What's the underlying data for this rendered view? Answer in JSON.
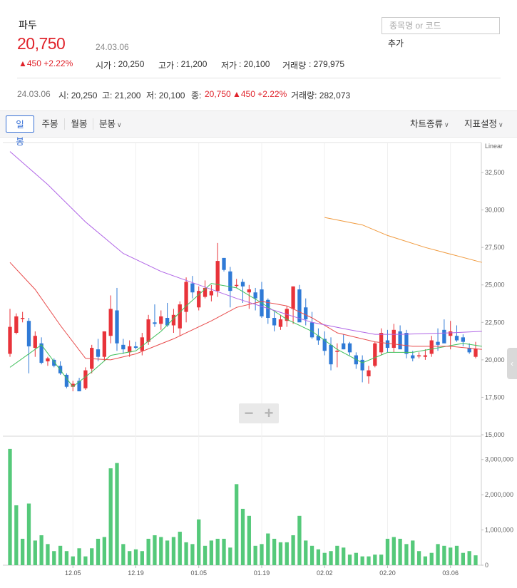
{
  "stock": {
    "name": "파두",
    "price": "20,750",
    "date": "24.03.06",
    "change": "▲450 +2.22%",
    "open_label": "시가",
    "open": ": 20,250",
    "high_label": "고가",
    "high": ": 21,200",
    "low_label": "저가",
    "low": ": 20,100",
    "volume_label": "거래량",
    "volume": ": 279,975"
  },
  "search": {
    "placeholder": "종목명 or 코드",
    "add_label": "추가"
  },
  "summary": {
    "date": "24.03.06",
    "open": "시: 20,250",
    "high": "고: 21,200",
    "low": "저: 20,100",
    "close_label": "종:",
    "close": "20,750",
    "change": "▲450 +2.22%",
    "volume": "거래량: 282,073"
  },
  "toolbar": {
    "tabs": [
      "일봉",
      "주봉",
      "월봉",
      "분봉"
    ],
    "active_tab": "일봉",
    "chart_type_label": "차트종류",
    "indicator_label": "지표설정"
  },
  "colors": {
    "up": "#e8333a",
    "down": "#2f7ad6",
    "ma5": "#3fbf5a",
    "ma20": "#e84b4b",
    "ma60": "#b065e6",
    "ma120": "#f09a3e",
    "volume": "#55c97a",
    "accent": "#3a72d6"
  },
  "icons": {
    "zoom_out": "−",
    "zoom_in": "+",
    "side_handle": "‹"
  },
  "chart_data": {
    "type": "candlestick",
    "scale_label": "Linear",
    "price_ticks": [
      32500,
      30000,
      27500,
      25000,
      22500,
      20000,
      17500,
      15000
    ],
    "price_tick_labels": [
      "32,500",
      "30,000",
      "27,500",
      "25,000",
      "22,500",
      "20,000",
      "17,500",
      "15,000"
    ],
    "ylim": [
      15000,
      34500
    ],
    "volume_ticks": [
      3000000,
      2000000,
      1000000,
      0
    ],
    "volume_tick_labels": [
      "3,000,000",
      "2,000,000",
      "1,000,000",
      "0"
    ],
    "volume_ylim": [
      0,
      3500000
    ],
    "x_tick_labels": [
      {
        "i": 10,
        "label": "12.05"
      },
      {
        "i": 20,
        "label": "12.19"
      },
      {
        "i": 30,
        "label": "01.05"
      },
      {
        "i": 40,
        "label": "01.19"
      },
      {
        "i": 50,
        "label": "02.02"
      },
      {
        "i": 60,
        "label": "02.20"
      },
      {
        "i": 70,
        "label": "03.06"
      }
    ],
    "candles": [
      {
        "o": 20400,
        "h": 23400,
        "l": 20200,
        "c": 22200,
        "v": 3300000
      },
      {
        "o": 21800,
        "h": 23100,
        "l": 21700,
        "c": 22900,
        "v": 1700000
      },
      {
        "o": 22800,
        "h": 23200,
        "l": 22500,
        "c": 22800,
        "v": 750000
      },
      {
        "o": 22600,
        "h": 22800,
        "l": 19100,
        "c": 20900,
        "v": 1750000
      },
      {
        "o": 20800,
        "h": 21900,
        "l": 20200,
        "c": 21600,
        "v": 700000
      },
      {
        "o": 21100,
        "h": 21500,
        "l": 19700,
        "c": 19800,
        "v": 850000
      },
      {
        "o": 19900,
        "h": 20200,
        "l": 19600,
        "c": 20100,
        "v": 600000
      },
      {
        "o": 20000,
        "h": 20100,
        "l": 19500,
        "c": 19600,
        "v": 400000
      },
      {
        "o": 19600,
        "h": 19900,
        "l": 19000,
        "c": 19100,
        "v": 550000
      },
      {
        "o": 19000,
        "h": 19100,
        "l": 18100,
        "c": 18200,
        "v": 400000
      },
      {
        "o": 18200,
        "h": 18600,
        "l": 17900,
        "c": 18400,
        "v": 250000
      },
      {
        "o": 18600,
        "h": 18800,
        "l": 17900,
        "c": 17900,
        "v": 480000
      },
      {
        "o": 18100,
        "h": 19500,
        "l": 18000,
        "c": 19300,
        "v": 250000
      },
      {
        "o": 19400,
        "h": 21000,
        "l": 19100,
        "c": 20800,
        "v": 480000
      },
      {
        "o": 20700,
        "h": 21400,
        "l": 19900,
        "c": 20200,
        "v": 750000
      },
      {
        "o": 20200,
        "h": 21900,
        "l": 19900,
        "c": 21900,
        "v": 800000
      },
      {
        "o": 21600,
        "h": 24300,
        "l": 21100,
        "c": 23400,
        "v": 2750000
      },
      {
        "o": 23300,
        "h": 24800,
        "l": 20600,
        "c": 21100,
        "v": 2900000
      },
      {
        "o": 21000,
        "h": 21400,
        "l": 20400,
        "c": 20700,
        "v": 600000
      },
      {
        "o": 20500,
        "h": 21300,
        "l": 20200,
        "c": 20900,
        "v": 400000
      },
      {
        "o": 20900,
        "h": 21200,
        "l": 20700,
        "c": 20800,
        "v": 450000
      },
      {
        "o": 20600,
        "h": 21800,
        "l": 20300,
        "c": 21500,
        "v": 400000
      },
      {
        "o": 21200,
        "h": 23000,
        "l": 21000,
        "c": 22700,
        "v": 750000
      },
      {
        "o": 22500,
        "h": 23700,
        "l": 22200,
        "c": 22400,
        "v": 850000
      },
      {
        "o": 22400,
        "h": 23300,
        "l": 22000,
        "c": 22900,
        "v": 800000
      },
      {
        "o": 22800,
        "h": 23800,
        "l": 22200,
        "c": 22300,
        "v": 700000
      },
      {
        "o": 22300,
        "h": 23400,
        "l": 21800,
        "c": 23000,
        "v": 800000
      },
      {
        "o": 22100,
        "h": 23900,
        "l": 21600,
        "c": 23700,
        "v": 950000
      },
      {
        "o": 23200,
        "h": 25500,
        "l": 22500,
        "c": 25200,
        "v": 650000
      },
      {
        "o": 25100,
        "h": 25600,
        "l": 24100,
        "c": 24500,
        "v": 600000
      },
      {
        "o": 23500,
        "h": 24900,
        "l": 23300,
        "c": 24600,
        "v": 1300000
      },
      {
        "o": 24200,
        "h": 25300,
        "l": 24100,
        "c": 24800,
        "v": 550000
      },
      {
        "o": 24300,
        "h": 25000,
        "l": 23900,
        "c": 24600,
        "v": 700000
      },
      {
        "o": 24600,
        "h": 27800,
        "l": 24200,
        "c": 26600,
        "v": 750000
      },
      {
        "o": 26800,
        "h": 26800,
        "l": 25900,
        "c": 26000,
        "v": 750000
      },
      {
        "o": 25900,
        "h": 26200,
        "l": 23500,
        "c": 24600,
        "v": 500000
      },
      {
        "o": 25000,
        "h": 25400,
        "l": 24800,
        "c": 25000,
        "v": 2300000
      },
      {
        "o": 25200,
        "h": 25400,
        "l": 23800,
        "c": 24900,
        "v": 1600000
      },
      {
        "o": 24500,
        "h": 25000,
        "l": 23400,
        "c": 24700,
        "v": 1400000
      },
      {
        "o": 24500,
        "h": 24800,
        "l": 23300,
        "c": 24100,
        "v": 550000
      },
      {
        "o": 24700,
        "h": 25200,
        "l": 22800,
        "c": 22900,
        "v": 600000
      },
      {
        "o": 24000,
        "h": 24100,
        "l": 22400,
        "c": 22800,
        "v": 900000
      },
      {
        "o": 22800,
        "h": 23200,
        "l": 21900,
        "c": 22300,
        "v": 750000
      },
      {
        "o": 22200,
        "h": 23000,
        "l": 22000,
        "c": 22700,
        "v": 650000
      },
      {
        "o": 22600,
        "h": 23600,
        "l": 22200,
        "c": 23400,
        "v": 650000
      },
      {
        "o": 23400,
        "h": 24900,
        "l": 22400,
        "c": 24900,
        "v": 850000
      },
      {
        "o": 24700,
        "h": 25000,
        "l": 22600,
        "c": 22500,
        "v": 1400000
      },
      {
        "o": 23500,
        "h": 24100,
        "l": 22300,
        "c": 22700,
        "v": 700000
      },
      {
        "o": 22500,
        "h": 23200,
        "l": 21400,
        "c": 21500,
        "v": 550000
      },
      {
        "o": 21600,
        "h": 22100,
        "l": 21000,
        "c": 21300,
        "v": 450000
      },
      {
        "o": 21400,
        "h": 21900,
        "l": 20300,
        "c": 20600,
        "v": 350000
      },
      {
        "o": 21000,
        "h": 21500,
        "l": 19300,
        "c": 19700,
        "v": 400000
      },
      {
        "o": 20600,
        "h": 21100,
        "l": 19500,
        "c": 20600,
        "v": 550000
      },
      {
        "o": 21100,
        "h": 21700,
        "l": 20700,
        "c": 20700,
        "v": 500000
      },
      {
        "o": 21100,
        "h": 21200,
        "l": 20300,
        "c": 20500,
        "v": 300000
      },
      {
        "o": 20300,
        "h": 20500,
        "l": 19400,
        "c": 19700,
        "v": 350000
      },
      {
        "o": 20000,
        "h": 20300,
        "l": 18500,
        "c": 19300,
        "v": 250000
      },
      {
        "o": 18900,
        "h": 19600,
        "l": 18400,
        "c": 19300,
        "v": 250000
      },
      {
        "o": 19600,
        "h": 21200,
        "l": 19500,
        "c": 21100,
        "v": 300000
      },
      {
        "o": 20500,
        "h": 22100,
        "l": 20300,
        "c": 21800,
        "v": 300000
      },
      {
        "o": 21300,
        "h": 22000,
        "l": 20500,
        "c": 20800,
        "v": 750000
      },
      {
        "o": 20800,
        "h": 22400,
        "l": 20500,
        "c": 22000,
        "v": 800000
      },
      {
        "o": 21900,
        "h": 22300,
        "l": 21000,
        "c": 20700,
        "v": 750000
      },
      {
        "o": 21800,
        "h": 22000,
        "l": 20100,
        "c": 20400,
        "v": 600000
      },
      {
        "o": 20300,
        "h": 20600,
        "l": 19900,
        "c": 20100,
        "v": 700000
      },
      {
        "o": 20300,
        "h": 20500,
        "l": 20100,
        "c": 20300,
        "v": 400000
      },
      {
        "o": 20200,
        "h": 20700,
        "l": 20000,
        "c": 20300,
        "v": 250000
      },
      {
        "o": 20400,
        "h": 21600,
        "l": 20200,
        "c": 21300,
        "v": 350000
      },
      {
        "o": 21200,
        "h": 22100,
        "l": 20600,
        "c": 21000,
        "v": 600000
      },
      {
        "o": 22000,
        "h": 22700,
        "l": 21400,
        "c": 21100,
        "v": 550000
      },
      {
        "o": 21600,
        "h": 22600,
        "l": 20700,
        "c": 21900,
        "v": 500000
      },
      {
        "o": 21600,
        "h": 22300,
        "l": 21200,
        "c": 21300,
        "v": 550000
      },
      {
        "o": 21500,
        "h": 21700,
        "l": 20900,
        "c": 21200,
        "v": 350000
      },
      {
        "o": 20800,
        "h": 21100,
        "l": 20400,
        "c": 20500,
        "v": 400000
      },
      {
        "o": 20200,
        "h": 21200,
        "l": 20100,
        "c": 20750,
        "v": 280000
      }
    ],
    "moving_averages": [
      {
        "name": "MA5",
        "color": "#3fbf5a",
        "points": [
          [
            0,
            19500
          ],
          [
            5,
            21000
          ],
          [
            10,
            18200
          ],
          [
            13,
            19200
          ],
          [
            16,
            20300
          ],
          [
            20,
            20600
          ],
          [
            24,
            21900
          ],
          [
            28,
            23600
          ],
          [
            32,
            25100
          ],
          [
            36,
            24800
          ],
          [
            40,
            23800
          ],
          [
            44,
            22700
          ],
          [
            48,
            21900
          ],
          [
            52,
            20700
          ],
          [
            56,
            19800
          ],
          [
            60,
            20500
          ],
          [
            64,
            20500
          ],
          [
            68,
            20800
          ],
          [
            72,
            21100
          ],
          [
            75,
            20900
          ]
        ]
      },
      {
        "name": "MA20",
        "color": "#e84b4b",
        "points": [
          [
            0,
            26500
          ],
          [
            4,
            24700
          ],
          [
            8,
            22300
          ],
          [
            12,
            20100
          ],
          [
            16,
            20000
          ],
          [
            20,
            20400
          ],
          [
            26,
            21400
          ],
          [
            32,
            22600
          ],
          [
            36,
            23500
          ],
          [
            40,
            23900
          ],
          [
            44,
            23600
          ],
          [
            48,
            22800
          ],
          [
            52,
            21800
          ],
          [
            58,
            21200
          ],
          [
            64,
            20900
          ],
          [
            70,
            20900
          ],
          [
            75,
            20700
          ]
        ]
      },
      {
        "name": "MA60",
        "color": "#b065e6",
        "points": [
          [
            0,
            33900
          ],
          [
            6,
            31700
          ],
          [
            12,
            29200
          ],
          [
            18,
            27100
          ],
          [
            24,
            25900
          ],
          [
            30,
            25000
          ],
          [
            36,
            24100
          ],
          [
            42,
            23300
          ],
          [
            48,
            22500
          ],
          [
            54,
            22000
          ],
          [
            58,
            21700
          ],
          [
            62,
            21700
          ],
          [
            70,
            21800
          ],
          [
            75,
            21900
          ]
        ]
      },
      {
        "name": "MA120",
        "color": "#f09a3e",
        "points": [
          [
            50,
            29500
          ],
          [
            56,
            29000
          ],
          [
            60,
            28300
          ],
          [
            66,
            27500
          ],
          [
            75,
            26500
          ]
        ]
      }
    ]
  }
}
